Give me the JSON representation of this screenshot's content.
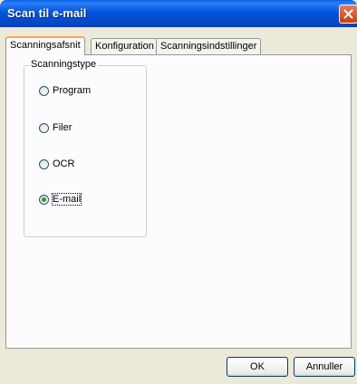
{
  "window": {
    "title": "Scan til e-mail"
  },
  "tabs": [
    {
      "label": "Scanningsafsnit",
      "active": true
    },
    {
      "label": "Konfiguration",
      "active": false
    },
    {
      "label": "Scanningsindstillinger",
      "active": false
    }
  ],
  "group": {
    "label": "Scanningstype",
    "options": [
      {
        "label": "Program",
        "selected": false
      },
      {
        "label": "Filer",
        "selected": false
      },
      {
        "label": "OCR",
        "selected": false
      },
      {
        "label": "E-mail",
        "selected": true
      }
    ]
  },
  "buttons": {
    "ok": "OK",
    "cancel": "Annuller"
  },
  "colors": {
    "titlebar": "#0554e0",
    "tab_highlight": "#f7a84a",
    "radio_selected": "#21a121"
  }
}
